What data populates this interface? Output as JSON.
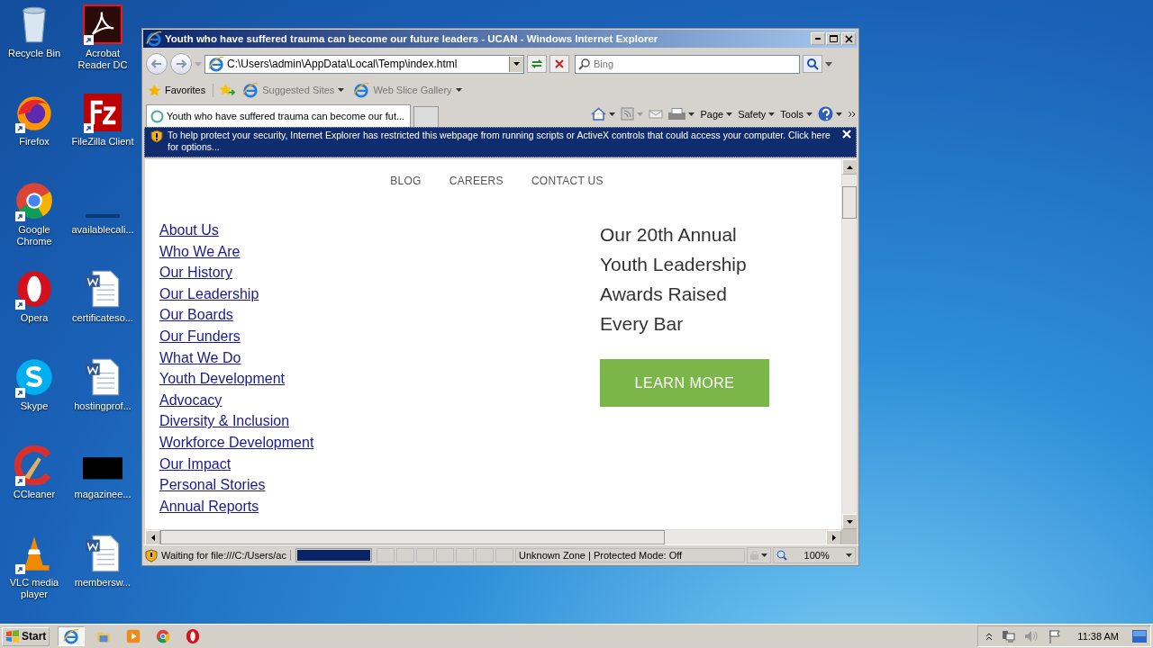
{
  "desktop": {
    "columns": [
      [
        {
          "label": "Recycle Bin",
          "kind": "recycle",
          "shortcut": false
        },
        {
          "label": "Firefox",
          "kind": "firefox",
          "shortcut": true
        },
        {
          "label": "Google Chrome",
          "kind": "chrome",
          "shortcut": true
        },
        {
          "label": "Opera",
          "kind": "opera",
          "shortcut": true
        },
        {
          "label": "Skype",
          "kind": "skype",
          "shortcut": true
        },
        {
          "label": "CCleaner",
          "kind": "ccleaner",
          "shortcut": true
        },
        {
          "label": "VLC media player",
          "kind": "vlc",
          "shortcut": true
        }
      ],
      [
        {
          "label": "Acrobat Reader DC",
          "kind": "acrobat",
          "shortcut": true
        },
        {
          "label": "FileZilla Client",
          "kind": "filezilla",
          "shortcut": true
        },
        {
          "label": "availablecali...",
          "kind": "blank",
          "shortcut": false
        },
        {
          "label": "certificateso...",
          "kind": "word",
          "shortcut": false
        },
        {
          "label": "hostingprof...",
          "kind": "word",
          "shortcut": false
        },
        {
          "label": "magazinee...",
          "kind": "black",
          "shortcut": false
        },
        {
          "label": "membersw...",
          "kind": "word",
          "shortcut": false
        }
      ]
    ]
  },
  "window": {
    "title": "Youth who have suffered trauma can become our future leaders - UCAN - Windows Internet Explorer",
    "address": "C:\\Users\\admin\\AppData\\Local\\Temp\\index.html",
    "search": {
      "placeholder": "Bing"
    },
    "favorites": [
      {
        "label": "Favorites",
        "kind": "star"
      },
      {
        "label": "Suggested Sites",
        "kind": "ie"
      },
      {
        "label": "Web Slice Gallery",
        "kind": "ie"
      }
    ],
    "tabs": [
      {
        "label": "Youth who have suffered trauma can become our fut...",
        "selected": true
      }
    ],
    "commands": [
      "Page",
      "Safety",
      "Tools"
    ],
    "infobar": "To help protect your security, Internet Explorer has restricted this webpage from running scripts or ActiveX controls that could access your computer. Click here for options...",
    "page": {
      "nav": [
        "BLOG",
        "CAREERS",
        "CONTACT US"
      ],
      "links": [
        "About Us",
        "Who We Are",
        "Our History",
        "Our Leadership",
        "Our Boards",
        "Our Funders",
        "What We Do",
        "Youth Development",
        "Advocacy",
        "Diversity & Inclusion",
        "Workforce Development",
        "Our Impact",
        "Personal Stories",
        "Annual Reports"
      ],
      "heading": "Our 20th Annual Youth Leadership Awards Raised Every Bar",
      "button": "LEARN MORE"
    },
    "status": {
      "text": "Waiting for file:///C:/Users/ac",
      "progress": {
        "level": 1
      },
      "zone": "Unknown Zone | Protected Mode: Off",
      "zoom": "100%"
    }
  },
  "taskbar": {
    "start": "Start",
    "apps": [
      {
        "kind": "ie",
        "selected": true
      },
      {
        "kind": "folder",
        "selected": false
      },
      {
        "kind": "media",
        "selected": false
      },
      {
        "kind": "chrome",
        "selected": false
      },
      {
        "kind": "opera",
        "selected": false
      }
    ],
    "clock": "11:38 AM"
  }
}
